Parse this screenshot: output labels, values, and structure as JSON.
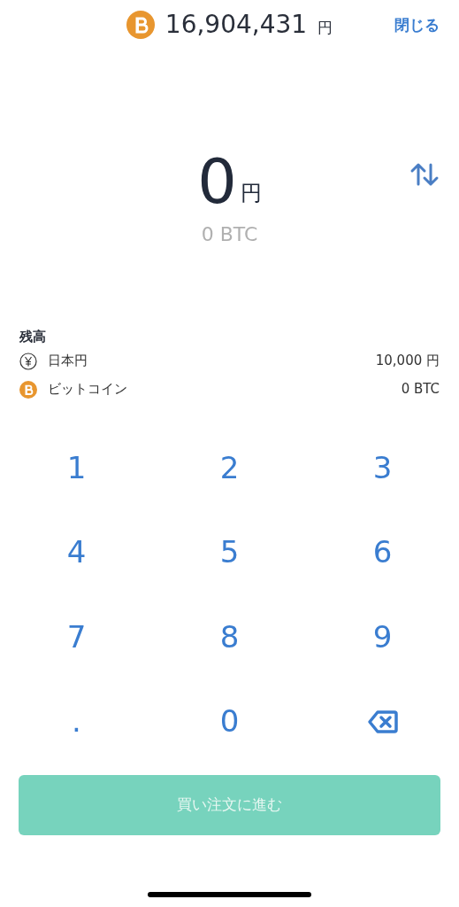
{
  "header": {
    "price": "16,904,431",
    "price_unit": "円",
    "close": "閉じる"
  },
  "amount": {
    "value": "0",
    "unit": "円",
    "converted": "0 BTC"
  },
  "balance": {
    "title": "残高",
    "rows": [
      {
        "kind": "yen",
        "name": "日本円",
        "value": "10,000 円"
      },
      {
        "kind": "btc",
        "name": "ビットコイン",
        "value": "0 BTC"
      }
    ]
  },
  "keypad": [
    {
      "kind": "key",
      "label": "1"
    },
    {
      "kind": "key",
      "label": "2"
    },
    {
      "kind": "key",
      "label": "3"
    },
    {
      "kind": "key",
      "label": "4"
    },
    {
      "kind": "key",
      "label": "5"
    },
    {
      "kind": "key",
      "label": "6"
    },
    {
      "kind": "key",
      "label": "7"
    },
    {
      "kind": "key",
      "label": "8"
    },
    {
      "kind": "key",
      "label": "9"
    },
    {
      "kind": "key",
      "label": "."
    },
    {
      "kind": "key",
      "label": "0"
    },
    {
      "kind": "backspace"
    }
  ],
  "submit": {
    "label": "買い注文に進む",
    "disabled": true
  }
}
